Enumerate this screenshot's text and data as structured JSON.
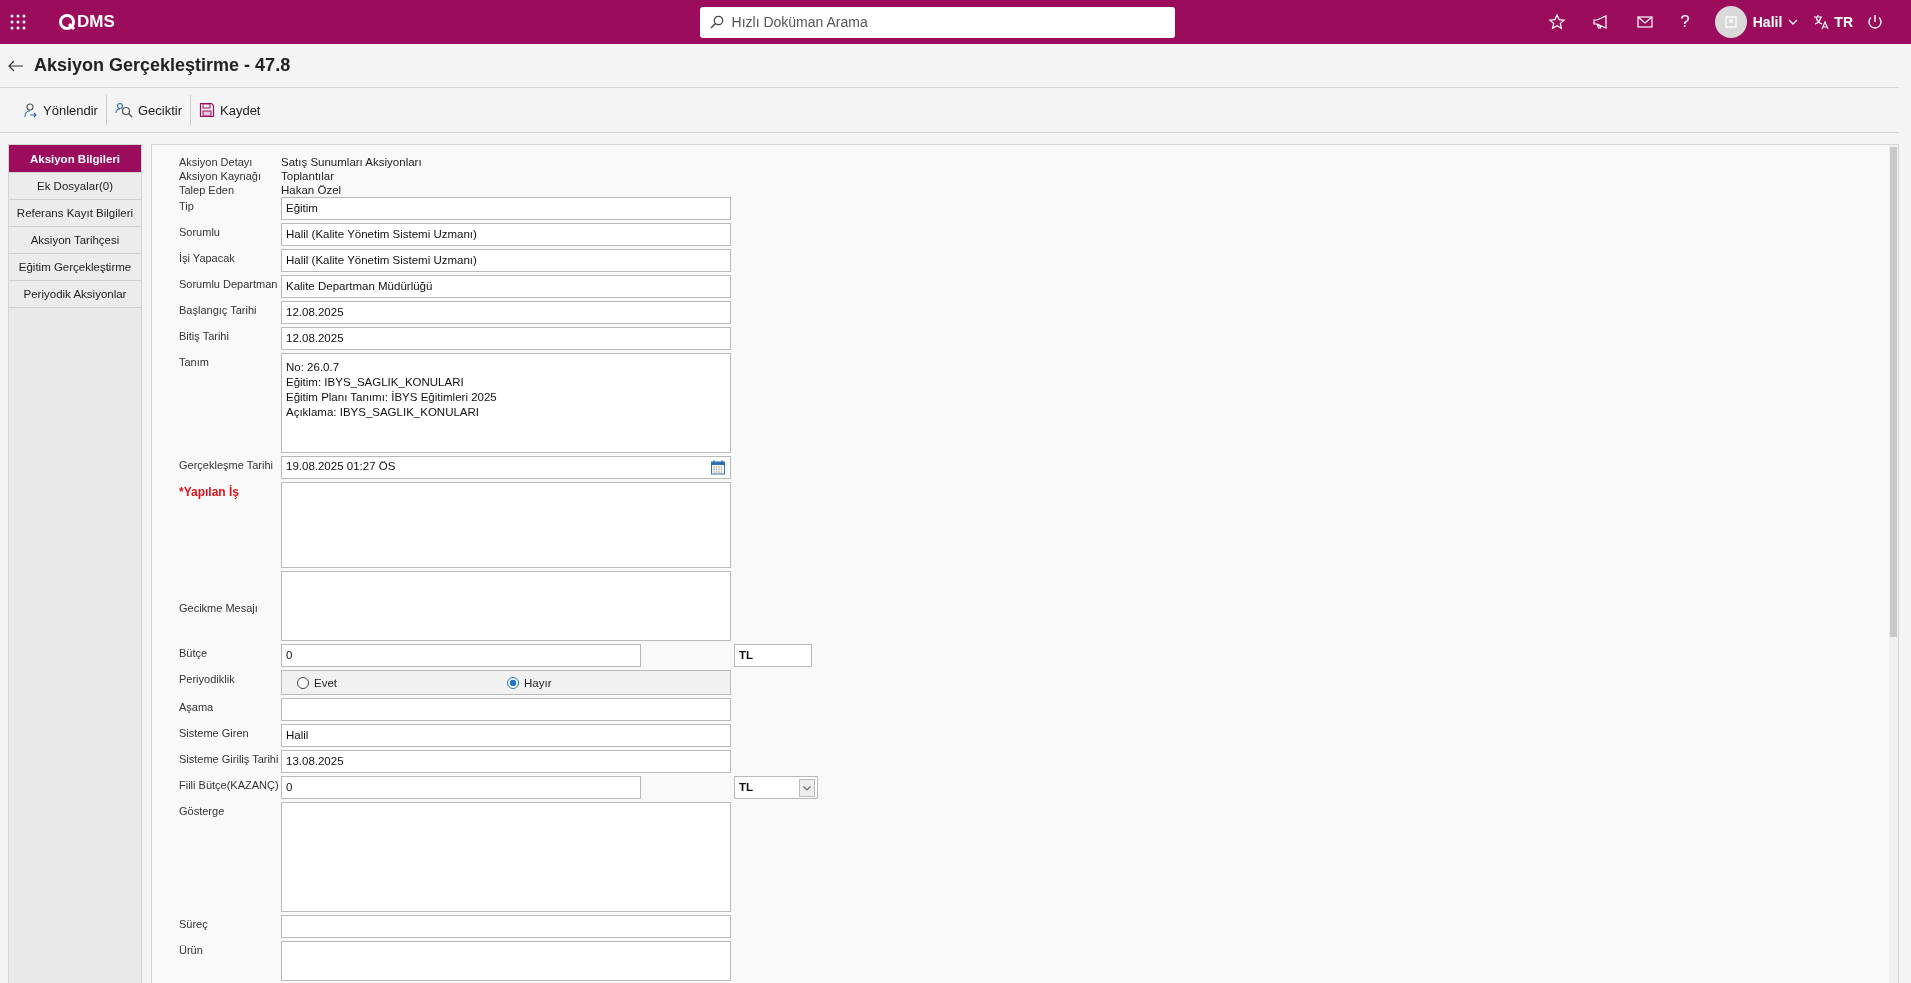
{
  "header": {
    "logo": "DMS",
    "search": {
      "placeholder": "Hızlı Doküman Arama"
    },
    "help": "?",
    "user": "Halil",
    "language": "TR"
  },
  "page": {
    "title": "Aksiyon Gerçekleştirme - 47.8"
  },
  "toolbar": [
    {
      "kind": "forward",
      "label": "Yönlendir"
    },
    {
      "kind": "delay",
      "label": "Geciktir"
    },
    {
      "kind": "save",
      "label": "Kaydet"
    }
  ],
  "sidebar": {
    "items": [
      {
        "label": "Aksiyon Bilgileri",
        "selected": true
      },
      {
        "label": "Ek Dosyalar(0)",
        "selected": false
      },
      {
        "label": "Referans Kayıt Bilgileri",
        "selected": false
      },
      {
        "label": "Aksiyon Tarihçesi",
        "selected": false
      },
      {
        "label": "Eğitim Gerçekleştirme",
        "selected": false
      },
      {
        "label": "Periyodik Aksiyonlar",
        "selected": false
      }
    ]
  },
  "info": [
    {
      "label": "Aksiyon Detayı",
      "value": "Satış Sunumları Aksiyonları"
    },
    {
      "label": "Aksiyon Kaynağı",
      "value": "Toplantılar"
    },
    {
      "label": "Talep Eden",
      "value": "Hakan Özel"
    }
  ],
  "fields": [
    {
      "kind": "text",
      "label": "Tip",
      "value": "Eğitim"
    },
    {
      "kind": "text",
      "label": "Sorumlu",
      "value": "Halil  (Kalite Yönetim Sistemi Uzmanı)"
    },
    {
      "kind": "text",
      "label": "İşi Yapacak",
      "value": "Halil  (Kalite Yönetim Sistemi Uzmanı)"
    },
    {
      "kind": "text",
      "label": "Sorumlu Departman",
      "value": "Kalite Departman Müdürlüğü"
    },
    {
      "kind": "text",
      "label": "Başlangıç Tarihi",
      "value": "12.08.2025"
    },
    {
      "kind": "text",
      "label": "Bitiş Tarihi",
      "value": "12.08.2025"
    },
    {
      "kind": "textarea",
      "label": "Tanım",
      "value": "No: 26.0.7\nEğitim: IBYS_SAGLIK_KONULARI\nEğitim Planı Tanımı: İBYS Eğitimleri 2025\nAçıklama: IBYS_SAGLIK_KONULARI"
    },
    {
      "kind": "date",
      "label": "Gerçekleşme Tarihi",
      "value": "19.08.2025 01:27 ÖS"
    },
    {
      "kind": "textarea",
      "label": "*Yapılan İş",
      "required": true
    },
    {
      "kind": "textarea",
      "label": "Gecikme Mesajı"
    },
    {
      "kind": "money",
      "label": "Bütçe",
      "value": "0",
      "currency": "TL"
    },
    {
      "kind": "radio",
      "label": "Periyodiklik",
      "options": [
        {
          "label": "Evet",
          "selected": false
        },
        {
          "label": "Hayır",
          "selected": true
        }
      ]
    },
    {
      "kind": "text",
      "label": "Aşama"
    },
    {
      "kind": "text",
      "label": "Sisteme Giren",
      "value": "Halil"
    },
    {
      "kind": "text",
      "label": "Sisteme Giriliş Tarihi",
      "value": "13.08.2025"
    },
    {
      "kind": "money-select",
      "label": "Fiili Bütçe(KAZANÇ)",
      "value": "0",
      "currency": "TL"
    },
    {
      "kind": "textarea",
      "label": "Gösterge"
    },
    {
      "kind": "text",
      "label": "Süreç"
    },
    {
      "kind": "textarea",
      "label": "Ürün"
    }
  ]
}
